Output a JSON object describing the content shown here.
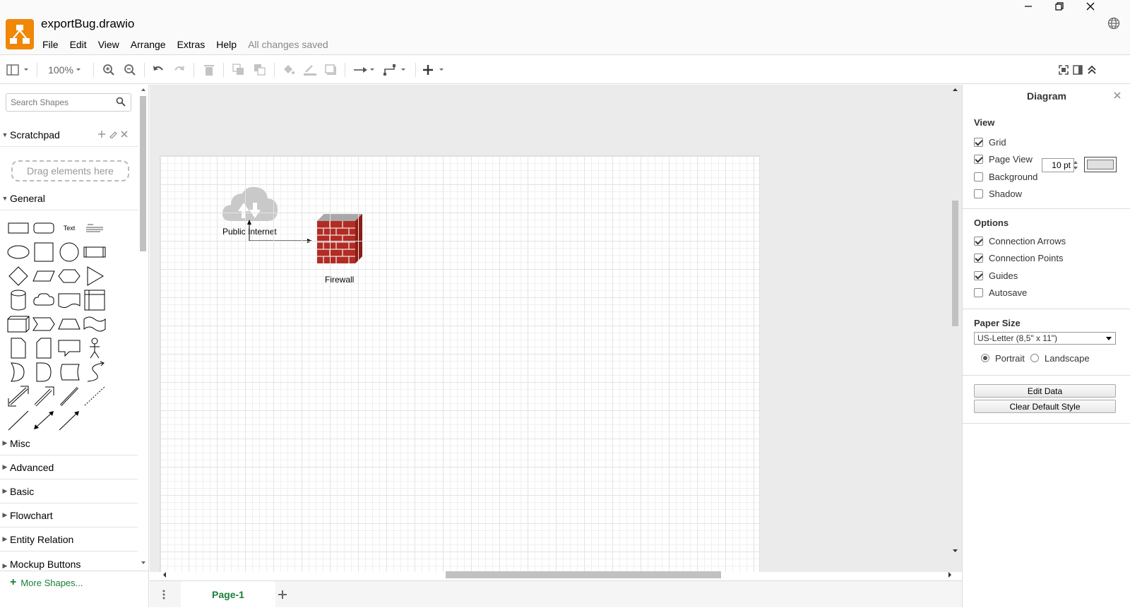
{
  "app": {
    "document_title": "exportBug.drawio",
    "save_status": "All changes saved"
  },
  "menu": [
    "File",
    "Edit",
    "View",
    "Arrange",
    "Extras",
    "Help"
  ],
  "toolbar": {
    "zoom": "100%"
  },
  "sidebar": {
    "search_placeholder": "Search Shapes",
    "scratchpad": {
      "label": "Scratchpad",
      "drop_hint": "Drag elements here"
    },
    "general_label": "General",
    "text_shape_label": "Text",
    "collapsed_sections": [
      "Misc",
      "Advanced",
      "Basic",
      "Flowchart",
      "Entity Relation",
      "Mockup Buttons"
    ],
    "more_shapes": "More Shapes..."
  },
  "diagram": {
    "shapes": [
      {
        "label": "Public Internet",
        "icon": "cloud-icon"
      },
      {
        "label": "Firewall",
        "icon": "firewall-icon"
      }
    ],
    "colors": {
      "cloud": "#c8c8c8",
      "firewall_brick": "#b32b22",
      "firewall_top": "#9a9a9a"
    }
  },
  "pages": {
    "tabs": [
      "Page-1"
    ]
  },
  "format_panel": {
    "title": "Diagram",
    "view": {
      "title": "View",
      "grid": {
        "label": "Grid",
        "checked": true,
        "size": "10 pt"
      },
      "page_view": {
        "label": "Page View",
        "checked": true
      },
      "background": {
        "label": "Background",
        "checked": false
      },
      "shadow": {
        "label": "Shadow",
        "checked": false
      }
    },
    "options": {
      "title": "Options",
      "connection_arrows": {
        "label": "Connection Arrows",
        "checked": true
      },
      "connection_points": {
        "label": "Connection Points",
        "checked": true
      },
      "guides": {
        "label": "Guides",
        "checked": true
      },
      "autosave": {
        "label": "Autosave",
        "checked": false
      }
    },
    "paper": {
      "title": "Paper Size",
      "size": "US-Letter (8,5\" x 11\")",
      "portrait": "Portrait",
      "landscape": "Landscape",
      "orientation": "Portrait"
    },
    "buttons": {
      "edit_data": "Edit Data",
      "clear_default_style": "Clear Default Style"
    }
  },
  "colors": {
    "accent_green": "#188038",
    "logo_orange": "#f08705"
  }
}
